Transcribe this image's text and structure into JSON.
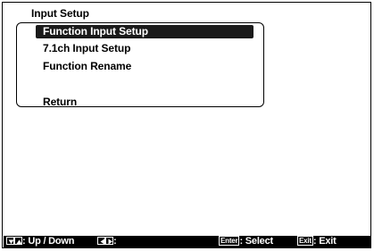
{
  "screen": {
    "title": "Input Setup",
    "menu": [
      {
        "label": "Function Input Setup",
        "selected": true
      },
      {
        "label": "7.1ch Input Setup",
        "selected": false
      },
      {
        "label": "Function Rename",
        "selected": false
      },
      {
        "label": "Return",
        "selected": false
      }
    ]
  },
  "footer": {
    "nav_label": ": Up / Down",
    "lr_label": ":",
    "enter_key": "Enter",
    "enter_label": ": Select",
    "exit_key": "Exit",
    "exit_label": ": Exit"
  },
  "icons": {
    "down": "triangle-down-icon",
    "up": "triangle-up-icon",
    "left": "triangle-left-icon",
    "right": "triangle-right-icon"
  }
}
